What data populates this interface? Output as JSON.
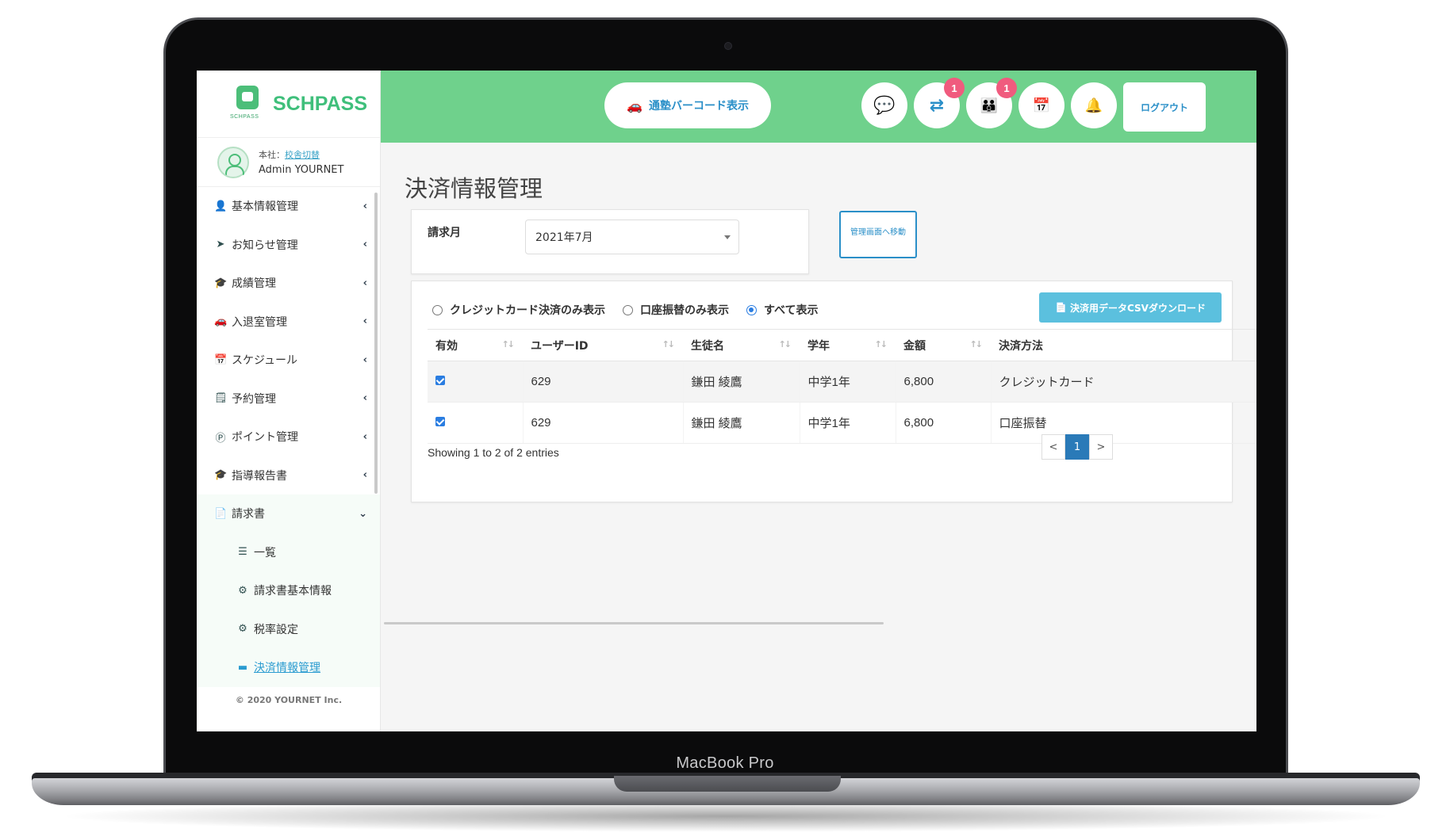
{
  "device_label": "MacBook Pro",
  "brand": {
    "name": "SCHPASS",
    "mini": "SCHPASS"
  },
  "user": {
    "school_prefix": "本社：",
    "school_link": "校舎切替",
    "name": "Admin YOURNET"
  },
  "sidebar": {
    "items": [
      {
        "icon": "user-icon",
        "glyph": "👤",
        "label": "基本情報管理"
      },
      {
        "icon": "paper-plane-icon",
        "glyph": "➤",
        "label": "お知らせ管理"
      },
      {
        "icon": "graduation-cap-icon",
        "glyph": "🎓",
        "label": "成績管理"
      },
      {
        "icon": "car-icon",
        "glyph": "🚗",
        "label": "入退室管理"
      },
      {
        "icon": "calendar-icon",
        "glyph": "📅",
        "label": "スケジュール"
      },
      {
        "icon": "reservation-icon",
        "glyph": "🗒",
        "label": "予約管理"
      },
      {
        "icon": "point-icon",
        "glyph": "Ⓟ",
        "label": "ポイント管理"
      },
      {
        "icon": "graduation-cap-icon",
        "glyph": "🎓",
        "label": "指導報告書"
      },
      {
        "icon": "file-icon",
        "glyph": "📄",
        "label": "請求書"
      }
    ],
    "submenu": [
      {
        "icon": "list-icon",
        "glyph": "☰",
        "label": "一覧"
      },
      {
        "icon": "gear-icon",
        "glyph": "⚙",
        "label": "請求書基本情報"
      },
      {
        "icon": "gear-icon",
        "glyph": "⚙",
        "label": "税率設定"
      },
      {
        "icon": "credit-card-icon",
        "glyph": "▬",
        "label": "決済情報管理"
      }
    ],
    "copyright": "© 2020 YOURNET Inc."
  },
  "topbar": {
    "barcode_button": "通塾バーコード表示",
    "badges": {
      "transfer": "1",
      "parents": "1"
    },
    "logout": "ログアウト"
  },
  "page": {
    "title": "決済情報管理",
    "filter_label": "請求月",
    "month_value": "2021年7月",
    "move_button": "管理画面へ移動"
  },
  "radios": [
    {
      "label": "クレジットカード決済のみ表示",
      "checked": false
    },
    {
      "label": "口座振替のみ表示",
      "checked": false
    },
    {
      "label": "すべて表示",
      "checked": true
    }
  ],
  "csv_button": "決済用データCSVダウンロード",
  "table": {
    "headers": [
      "有効",
      "ユーザーID",
      "生徒名",
      "学年",
      "金額",
      "決済方法"
    ],
    "rows": [
      {
        "user_id": "629",
        "name": "鎌田 綾鷹",
        "grade": "中学1年",
        "amount": "6,800",
        "method": "クレジットカード"
      },
      {
        "user_id": "629",
        "name": "鎌田 綾鷹",
        "grade": "中学1年",
        "amount": "6,800",
        "method": "口座振替"
      }
    ]
  },
  "showing": "Showing 1 to 2 of 2 entries",
  "pager": {
    "prev": "<",
    "current": "1",
    "next": ">"
  },
  "colors": {
    "topbar": "#6fd18c",
    "accent": "#2a8fc8",
    "badge": "#f05b7e",
    "csv": "#5bc0de"
  }
}
